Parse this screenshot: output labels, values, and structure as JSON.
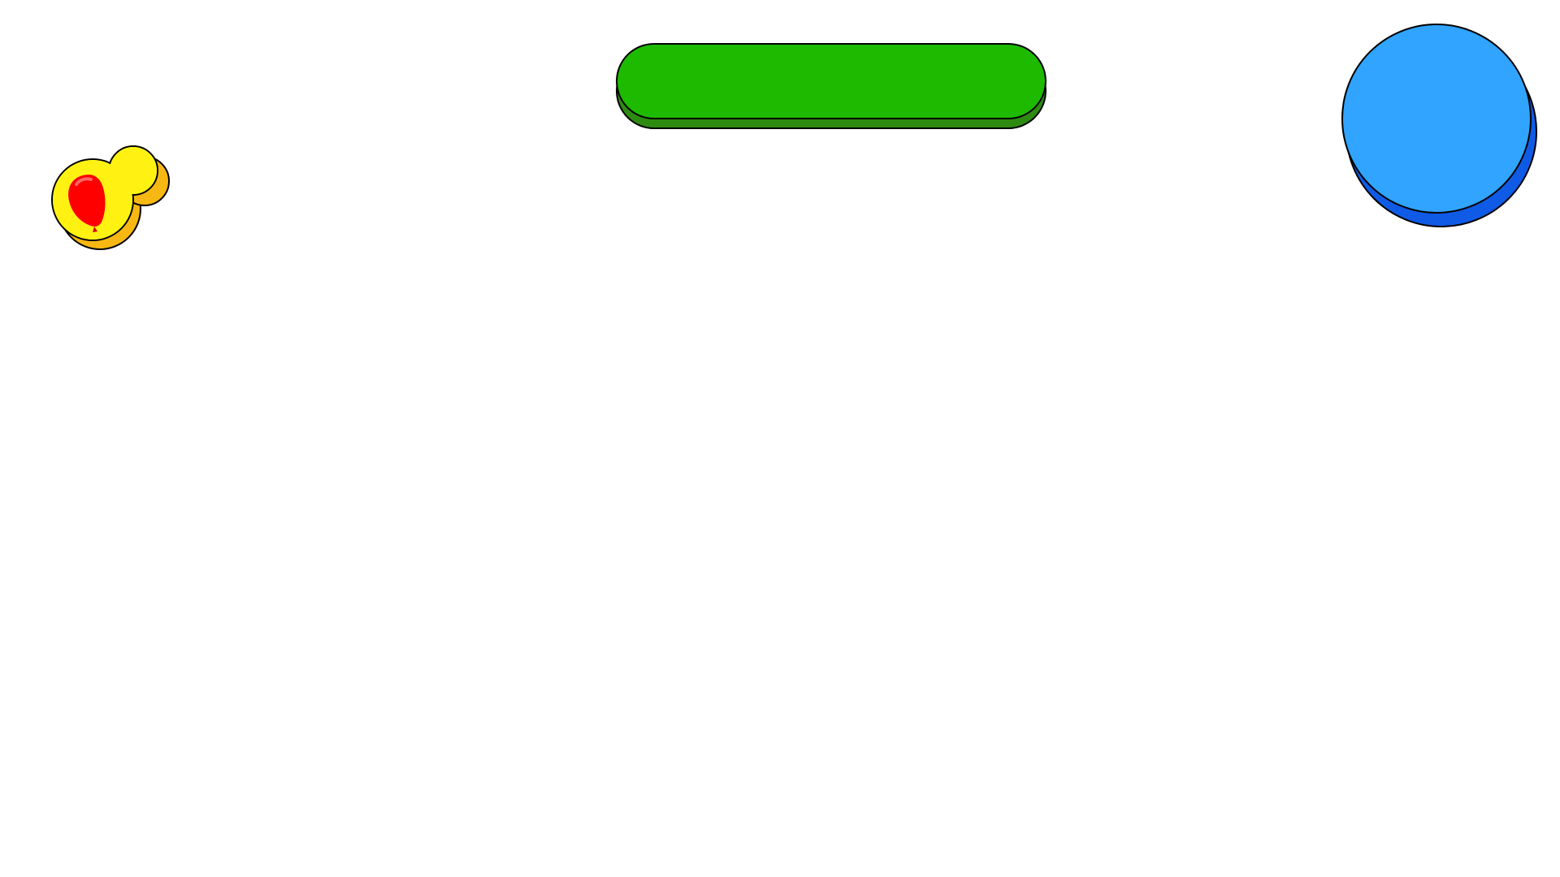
{
  "game": {
    "hud": {
      "balloon_badge": {
        "icon": "red-balloon-icon",
        "colors": {
          "badge": "#FFF212",
          "badge_shadow": "#F7B814",
          "balloon": "#FF0000",
          "outline": "#000000"
        }
      },
      "progress_bar": {
        "progress": 1.0,
        "colors": {
          "fill": "#1DBA00",
          "shadow": "#2E8B12",
          "outline": "#000000"
        }
      },
      "round_button": {
        "colors": {
          "fill": "#30A4FF",
          "shadow": "#0F5BE6",
          "outline": "#000000"
        }
      }
    }
  }
}
